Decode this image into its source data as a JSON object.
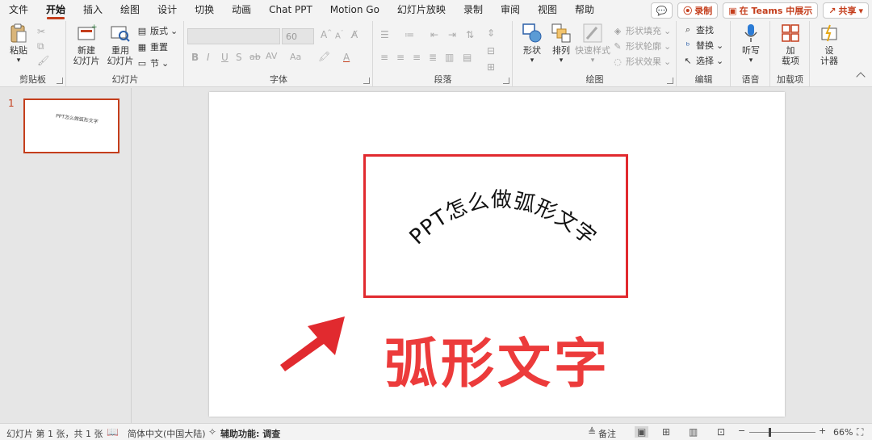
{
  "menu": {
    "tabs": [
      "文件",
      "开始",
      "插入",
      "绘图",
      "设计",
      "切换",
      "动画",
      "Chat PPT",
      "Motion Go",
      "幻灯片放映",
      "录制",
      "审阅",
      "视图",
      "帮助"
    ],
    "active": "开始",
    "right": {
      "comment_icon": "comment-icon",
      "record": "录制",
      "teams": "在 Teams 中展示",
      "share": "共享"
    }
  },
  "ribbon": {
    "clipboard": {
      "label": "剪贴板",
      "paste": "粘贴"
    },
    "slides": {
      "label": "幻灯片",
      "new_slide_1": "新建",
      "new_slide_2": "幻灯片",
      "reuse_1": "重用",
      "reuse_2": "幻灯片",
      "layout": "版式",
      "reset": "重置",
      "section": "节"
    },
    "font": {
      "label": "字体",
      "font_name": "",
      "font_size": "60",
      "bold": "B",
      "italic": "I",
      "underline": "U",
      "shadow": "S",
      "strike": "ab",
      "spacing": "AV",
      "case": "Aa",
      "grow": "A",
      "shrink": "A"
    },
    "paragraph": {
      "label": "段落"
    },
    "drawing": {
      "label": "绘图",
      "shapes": "形状",
      "arrange": "排列",
      "quick_styles": "快速样式",
      "fill": "形状填充",
      "outline": "形状轮廓",
      "effects": "形状效果"
    },
    "editing": {
      "label": "编辑",
      "find": "查找",
      "replace": "替换",
      "select": "选择"
    },
    "voice": {
      "label": "语音",
      "dictate": "听写"
    },
    "addins": {
      "label": "加载项",
      "addins_1": "加",
      "addins_2": "载项"
    },
    "designer": {
      "label_1": "设",
      "label_2": "计器"
    }
  },
  "thumbnails": [
    {
      "number": "1",
      "text": "PPT怎么做弧形文字"
    }
  ],
  "slide": {
    "arc_text": "PPT怎么做弧形文字",
    "big_title": "弧形文字",
    "accent_red": "#e12a2f",
    "title_red": "#ec3b3b"
  },
  "status": {
    "slide_info": "幻灯片 第 1 张，共 1 张",
    "language": "简体中文(中国大陆)",
    "accessibility": "辅助功能: 调查",
    "notes": "备注",
    "zoom": "66%"
  }
}
